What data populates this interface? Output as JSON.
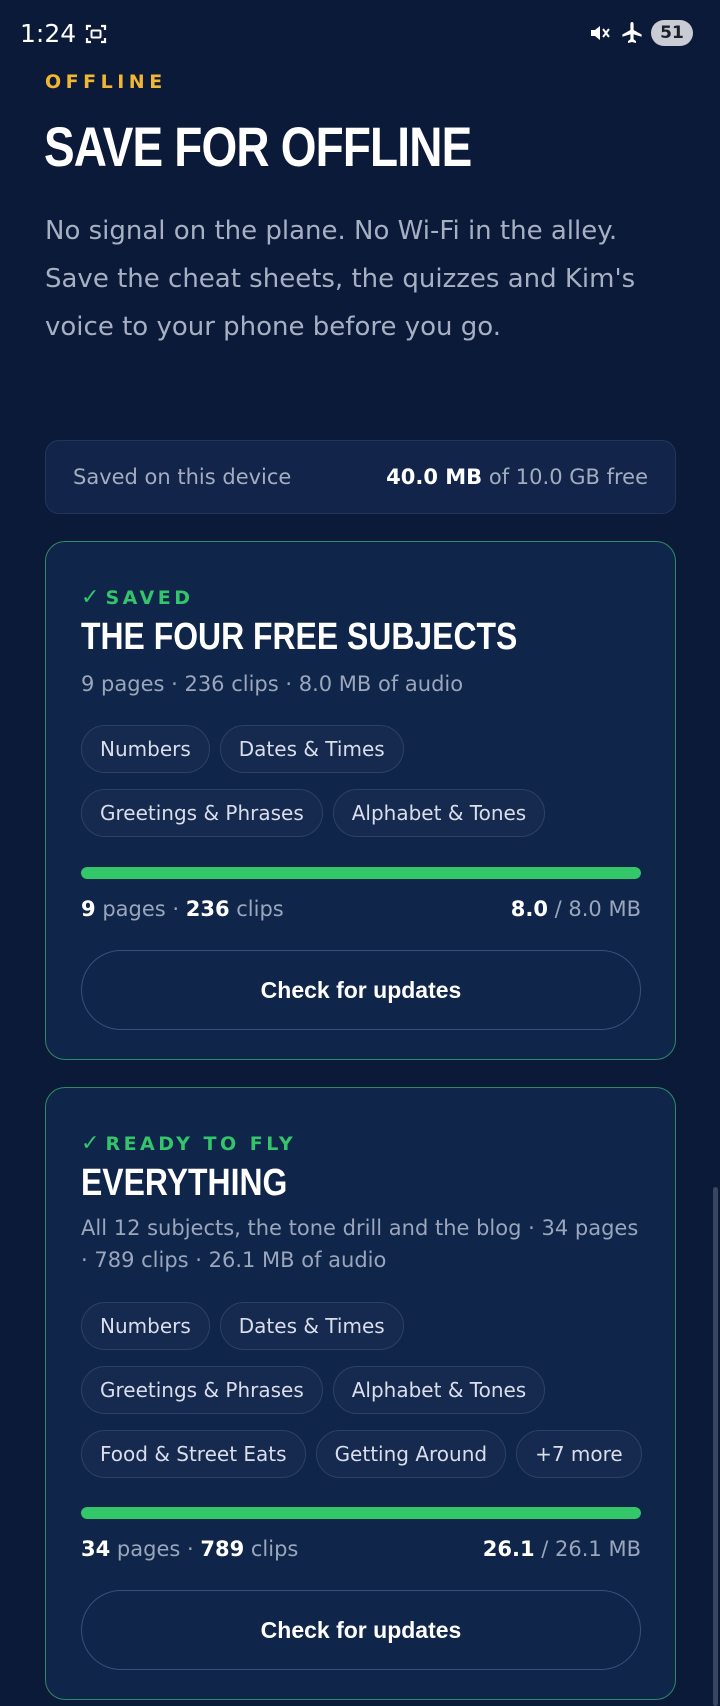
{
  "status_bar": {
    "time": "1:24",
    "battery": "51",
    "icons": [
      "screenshot-icon",
      "muted-icon",
      "airplane-mode-icon"
    ]
  },
  "header": {
    "eyebrow": "OFFLINE",
    "title": "SAVE FOR OFFLINE",
    "intro": "No signal on the plane. No Wi-Fi in the alley. Save the cheat sheets, the quizzes and Kim's voice to your phone before you go."
  },
  "storage": {
    "label": "Saved on this device",
    "used": "40.0 MB",
    "free_text": "of 10.0 GB free"
  },
  "packs": [
    {
      "status": "SAVED",
      "title": "THE FOUR FREE SUBJECTS",
      "description": "9 pages · 236 clips · 8.0 MB of audio",
      "chips": [
        "Numbers",
        "Dates & Times",
        "Greetings & Phrases",
        "Alphabet & Tones"
      ],
      "progress": 1.0,
      "pages": "9",
      "pages_label": "pages",
      "clips": "236",
      "clips_label": "clips",
      "downloaded": "8.0",
      "total": "/ 8.0 MB",
      "button": "Check for updates"
    },
    {
      "status": "READY TO FLY",
      "title": "EVERYTHING",
      "description": "All 12 subjects, the tone drill and the blog · 34 pages · 789 clips · 26.1 MB of audio",
      "chips": [
        "Numbers",
        "Dates & Times",
        "Greetings & Phrases",
        "Alphabet & Tones",
        "Food & Street Eats",
        "Getting Around",
        "+7 more"
      ],
      "progress": 1.0,
      "pages": "34",
      "pages_label": "pages",
      "clips": "789",
      "clips_label": "clips",
      "downloaded": "26.1",
      "total": "/ 26.1 MB",
      "button": "Check for updates"
    }
  ],
  "colors": {
    "background": "#0c1a3a",
    "accent": "#f2b632",
    "success": "#34c46b",
    "card_border": "#2e8a66"
  }
}
